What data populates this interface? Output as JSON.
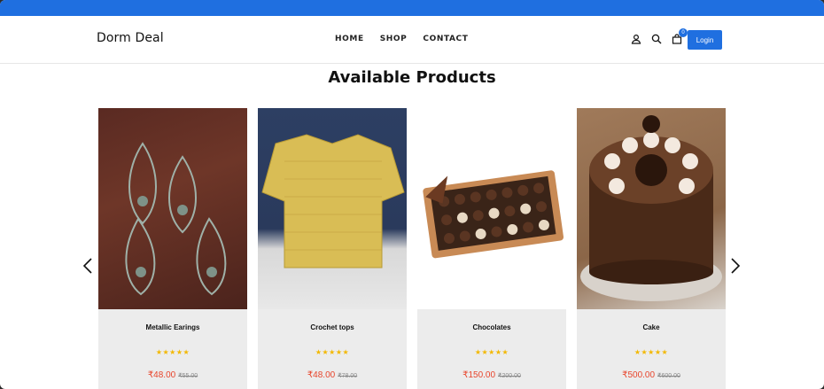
{
  "header": {
    "brand": "Dorm Deal",
    "nav": [
      "HOME",
      "SHOP",
      "CONTACT"
    ],
    "icons": [
      "user-icon",
      "search-icon",
      "cart-icon"
    ],
    "cart_count": "0",
    "login_label": "Login"
  },
  "section": {
    "title": "Available Products"
  },
  "products": [
    {
      "name": "Metallic Earings",
      "stars": "★★★★★",
      "rating": 4.5,
      "price": "₹48.00",
      "old_price": "₹55.00"
    },
    {
      "name": "Crochet tops",
      "stars": "★★★★★",
      "rating": 4.5,
      "price": "₹48.00",
      "old_price": "₹78.00"
    },
    {
      "name": "Chocolates",
      "stars": "★★★★★",
      "rating": 4.5,
      "price": "₹150.00",
      "old_price": "₹200.00"
    },
    {
      "name": "Cake",
      "stars": "★★★★★",
      "rating": 4.5,
      "price": "₹500.00",
      "old_price": "₹600.00"
    }
  ],
  "colors": {
    "accent": "#1f6fe0",
    "price": "#e8452c",
    "star": "#f3b800",
    "card_bg": "#ececec"
  }
}
